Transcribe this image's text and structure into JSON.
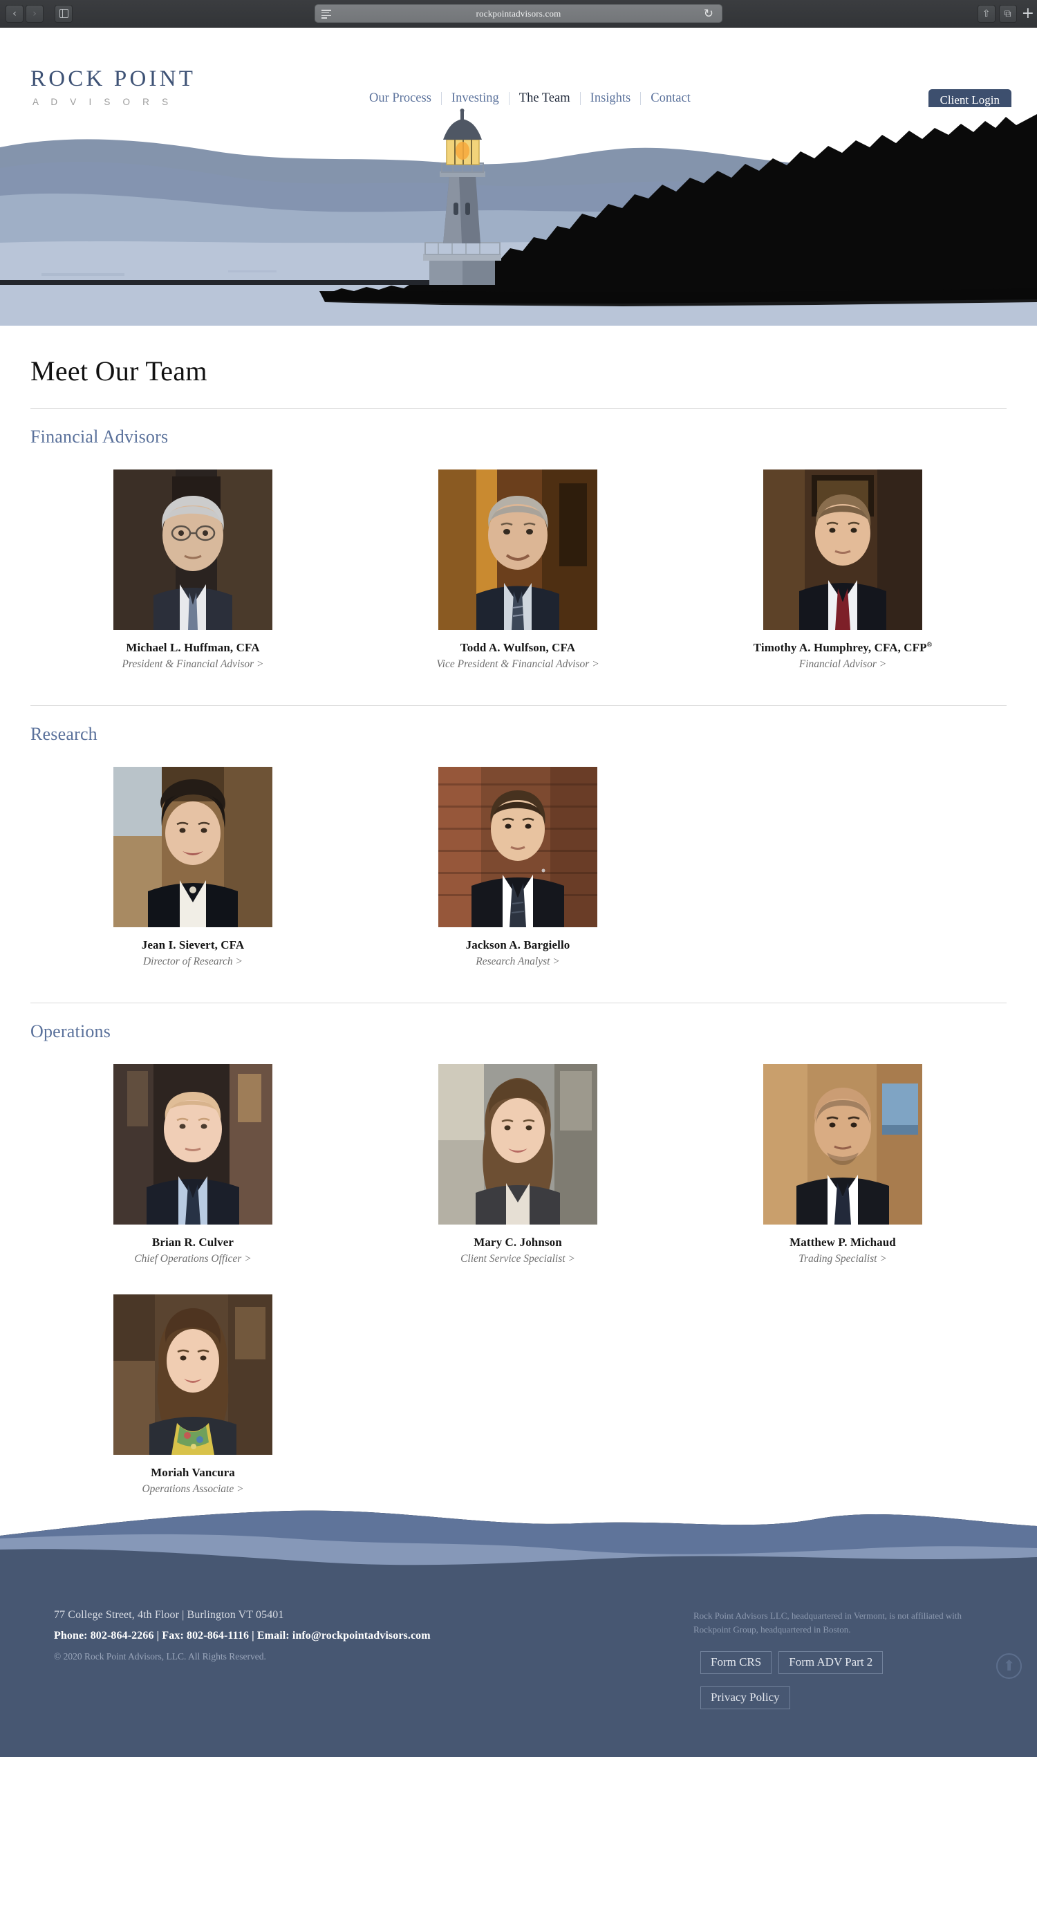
{
  "browser": {
    "url": "rockpointadvisors.com",
    "back_icon": "‹",
    "forward_icon": "›",
    "sidebar_icon": "sidebar-icon",
    "reader_icon": "reader-view-icon",
    "reload_icon": "↻",
    "share_icon": "⇧",
    "tabs_icon": "⧉",
    "newtab_icon": "+"
  },
  "header": {
    "logo_main": "ROCK POINT",
    "logo_sub": "A D V I S O R S",
    "nav": [
      {
        "label": "Our Process",
        "active": false
      },
      {
        "label": "Investing",
        "active": false
      },
      {
        "label": "The Team",
        "active": true
      },
      {
        "label": "Insights",
        "active": false
      },
      {
        "label": "Contact",
        "active": false
      }
    ],
    "client_login": "Client Login"
  },
  "hero": {
    "alt": "lighthouse-illustration",
    "colors": {
      "sky": "#ffffff",
      "far_mountain": "#6e819d",
      "mid_mountain": "#8897b2",
      "near_mountain": "#9fafc6",
      "water": "#b6c2d6",
      "headland": "#0a0a0a",
      "lamp": "#f0c14b",
      "tower": "#6b7585"
    }
  },
  "main": {
    "page_title": "Meet Our Team",
    "sections": [
      {
        "heading": "Financial Advisors",
        "members": [
          {
            "name": "Michael L. Huffman, CFA",
            "role": "President & Financial Advisor >",
            "photo": "portrait-huffman"
          },
          {
            "name": "Todd A. Wulfson, CFA",
            "role": "Vice President & Financial Advisor >",
            "photo": "portrait-wulfson"
          },
          {
            "name": "Timothy A. Humphrey, CFA, CFP",
            "name_sup": "®",
            "role": "Financial Advisor >",
            "photo": "portrait-humphrey"
          }
        ]
      },
      {
        "heading": "Research",
        "members": [
          {
            "name": "Jean I. Sievert, CFA",
            "role": "Director of Research >",
            "photo": "portrait-sievert"
          },
          {
            "name": "Jackson A. Bargiello",
            "role": "Research Analyst >",
            "photo": "portrait-bargiello"
          }
        ]
      },
      {
        "heading": "Operations",
        "members": [
          {
            "name": "Brian R. Culver",
            "role": "Chief Operations Officer >",
            "photo": "portrait-culver"
          },
          {
            "name": "Mary C. Johnson",
            "role": "Client Service Specialist >",
            "photo": "portrait-johnson"
          },
          {
            "name": "Matthew P. Michaud",
            "role": "Trading Specialist >",
            "photo": "portrait-michaud"
          },
          {
            "name": "Moriah Vancura",
            "role": "Operations Associate >",
            "photo": "portrait-vancura"
          }
        ]
      }
    ]
  },
  "footer": {
    "address": "77 College Street, 4th Floor | Burlington VT 05401",
    "contact": "Phone: 802-864-2266 | Fax: 802-864-1116 | Email: info@rockpointadvisors.com",
    "copyright": "© 2020 Rock Point Advisors, LLC. All Rights Reserved.",
    "disclaimer": "Rock Point Advisors LLC, headquartered in Vermont, is not affiliated with Rockpoint Group, headquartered in Boston.",
    "links": [
      {
        "label": "Form CRS"
      },
      {
        "label": "Form ADV Part 2"
      },
      {
        "label": "Privacy Policy"
      }
    ],
    "to_top_icon": "⬆",
    "bg_color": "#475772"
  }
}
